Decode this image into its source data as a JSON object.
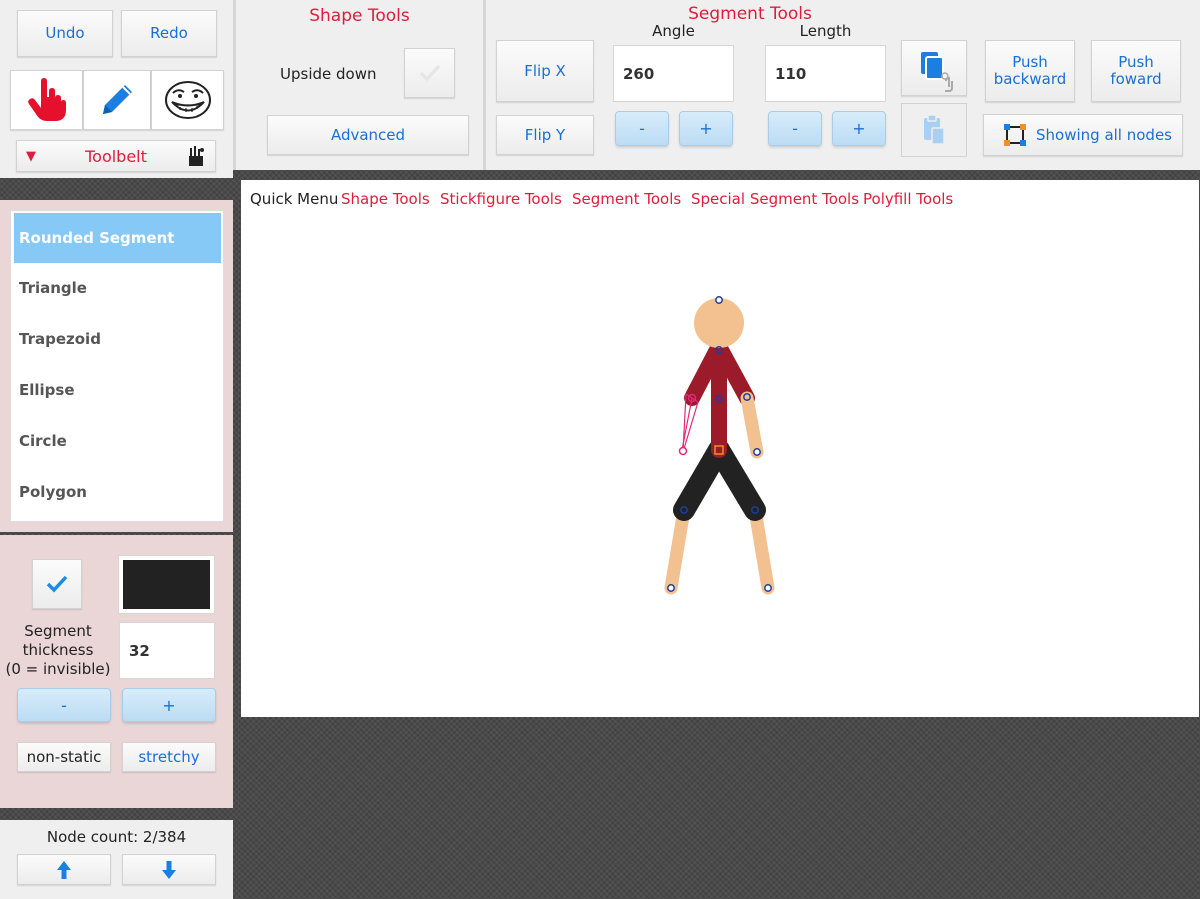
{
  "toolbar": {
    "undo": "Undo",
    "redo": "Redo",
    "tools": [
      "hand-pointer-icon",
      "pencil-icon",
      "troll-face-icon"
    ],
    "toolbelt_label": "Toolbelt"
  },
  "shape_list": {
    "items": [
      "Rounded Segment",
      "Triangle",
      "Trapezoid",
      "Ellipse",
      "Circle",
      "Polygon"
    ],
    "selected": "Rounded Segment"
  },
  "segment_props": {
    "checkbox_checked": true,
    "color": "#222222",
    "thickness_label_1": "Segment",
    "thickness_label_2": "thickness",
    "thickness_label_3": "(0 = invisible)",
    "thickness_value": "32",
    "minus": "-",
    "plus": "+",
    "non_static": "non-static",
    "stretchy": "stretchy"
  },
  "node_panel": {
    "node_count": "Node count: 2/384"
  },
  "shape_tools": {
    "title": "Shape Tools",
    "upside_down_label": "Upside down",
    "advanced": "Advanced"
  },
  "segment_tools": {
    "title": "Segment Tools",
    "flip_x": "Flip X",
    "flip_y": "Flip Y",
    "angle_label": "Angle",
    "angle_value": "260",
    "length_label": "Length",
    "length_value": "110",
    "minus": "-",
    "plus": "+",
    "push_backward": "Push backward",
    "push_forward": "Push foward",
    "showing_nodes": "Showing all nodes"
  },
  "quick_menu": {
    "label": "Quick Menu",
    "items": [
      "Shape Tools",
      "Stickfigure Tools",
      "Segment Tools",
      "Special Segment Tools",
      "Polyfill Tools"
    ]
  },
  "colors": {
    "accent_blue": "#1a6fd6",
    "title_red": "#e01c3c",
    "selected_item": "#86c9f7",
    "skin": "#f3c08f",
    "torso": "#9b1b2b",
    "legs": "#222222"
  }
}
